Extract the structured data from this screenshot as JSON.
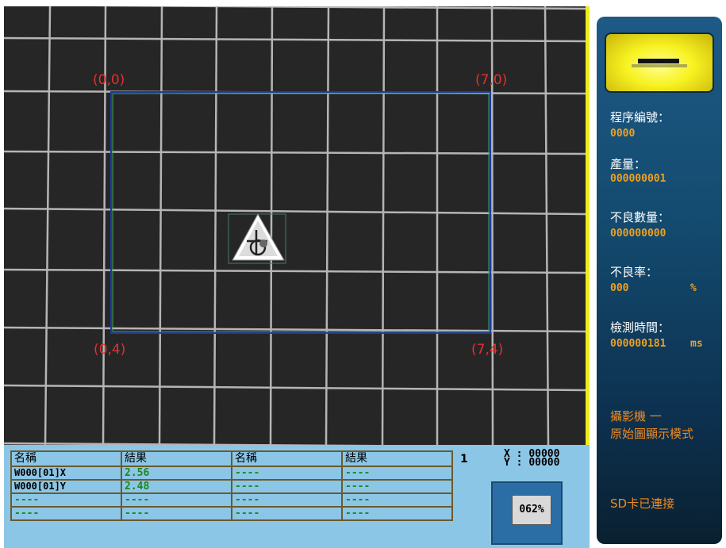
{
  "camera": {
    "corners": {
      "top_left": "(0,0)",
      "top_right": "(7,0)",
      "bottom_left": "(0,4)",
      "bottom_right": "(7,4)"
    }
  },
  "colors": {
    "camera_bg": "#262626",
    "grid_line": "#b5b5b5",
    "roi_frame": "#1f3aa0",
    "roi_inner": "#3aa860",
    "coord_text": "#e23030",
    "accent_yellow": "#ecec1f",
    "panel_blue": "#134a6e",
    "value_orange": "#f0a020",
    "result_green": "#1a8a1a",
    "bottom_bg": "#8cc6e6"
  },
  "center_icon": "warning-triangle-icon",
  "side_panel": {
    "logo_icon": "camera-logo-icon",
    "program_label": "程序編號：",
    "program_value": "0000",
    "output_label": "產量：",
    "output_value": "000000001",
    "defect_count_label": "不良數量：",
    "defect_count_value": "000000000",
    "defect_rate_label": "不良率：",
    "defect_rate_value": "000",
    "defect_rate_unit": "%",
    "inspect_time_label": "檢測時間：",
    "inspect_time_value": "000000181",
    "inspect_time_unit": "ms",
    "camera_name": "攝影機 一",
    "display_mode": "原始圖顯示模式",
    "sd_status": "SD卡已連接"
  },
  "results": {
    "headers": [
      "名稱",
      "結果",
      "名稱",
      "結果"
    ],
    "rows": [
      [
        "W000[01]X",
        "2.56",
        "----",
        "----"
      ],
      [
        "W000[01]Y",
        "2.48",
        "----",
        "----"
      ],
      [
        "----",
        "----",
        "----",
        "----"
      ],
      [
        "----",
        "----",
        "----",
        "----"
      ]
    ],
    "page": "1",
    "x_label": "X :",
    "x_value": "00000",
    "y_label": "Y :",
    "y_value": "00000",
    "percent": "062%"
  }
}
